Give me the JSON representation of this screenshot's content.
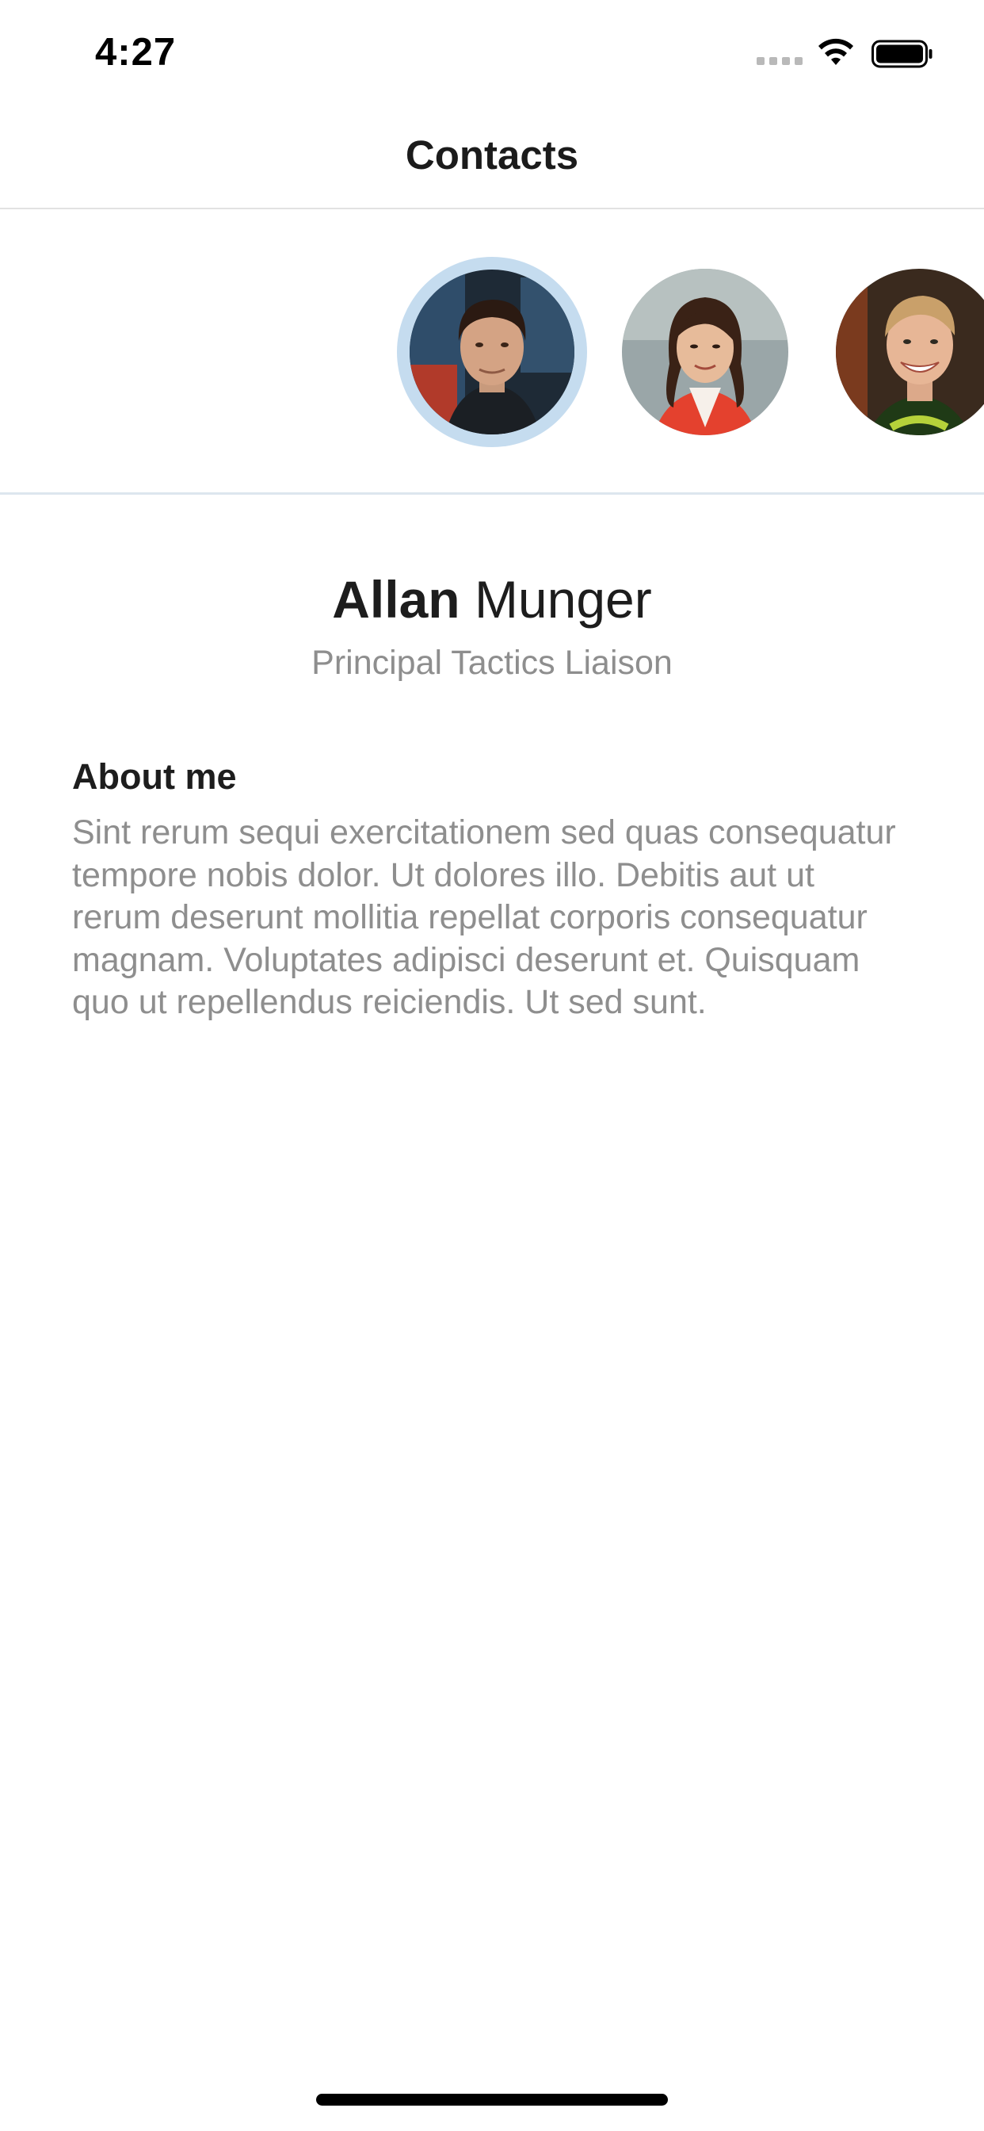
{
  "status_bar": {
    "time": "4:27",
    "icons": [
      "cellular-signal-icon",
      "wifi-icon",
      "battery-icon"
    ]
  },
  "nav": {
    "title": "Contacts"
  },
  "carousel": {
    "contacts": [
      {
        "icon": "avatar-allan-munger",
        "selected": true
      },
      {
        "icon": "avatar-contact-2",
        "selected": false
      },
      {
        "icon": "avatar-contact-3",
        "selected": false
      }
    ],
    "selected_ring_color": "#c5dcef"
  },
  "profile": {
    "first_name": "Allan",
    "last_name": "Munger",
    "job_title": "Principal Tactics Liaison"
  },
  "about": {
    "heading": "About me",
    "body": "Sint rerum sequi exercitationem sed quas consequatur tempore nobis dolor. Ut dolores illo. Debitis aut ut rerum deserunt mollitia repellat corporis consequatur magnam. Voluptates adipisci deserunt et. Quisquam quo ut repellendus reiciendis. Ut sed sunt."
  },
  "colors": {
    "primary_text": "#1d1d1d",
    "secondary_text": "#8e8e8e",
    "divider": "#e2e2e2",
    "accent_ring": "#c5dcef"
  }
}
